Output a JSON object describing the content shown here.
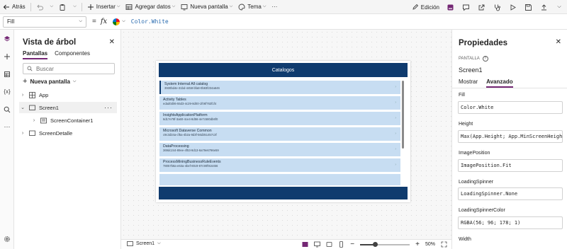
{
  "toolbar": {
    "back_label": "Atrás",
    "insert_label": "Insertar",
    "add_data_label": "Agregar datos",
    "new_screen_label": "Nueva pantalla",
    "theme_label": "Tema",
    "more_label": "···",
    "edit_label": "Edición"
  },
  "formula": {
    "property": "Fill",
    "equals": "=",
    "fx": "fx",
    "value": "Color.White"
  },
  "tree": {
    "title": "Vista de árbol",
    "tabs": [
      "Pantallas",
      "Componentes"
    ],
    "search_placeholder": "Buscar",
    "new_screen": "Nueva pantalla",
    "items": [
      {
        "label": "App"
      },
      {
        "label": "Screen1"
      },
      {
        "label": "ScreenContainer1"
      },
      {
        "label": "ScreenDetalle"
      }
    ],
    "more": "···"
  },
  "app": {
    "header_title": "Catalogos",
    "gallery": [
      {
        "title": "System Internal All catalog",
        "subtitle": "3930bd4e-31bd-4458-bfa8-0b83f234a646"
      },
      {
        "title": "Activity Tables",
        "subtitle": "edad0d06-55d3-4c29-8d00-1f06f763f1f4"
      },
      {
        "title": "InsightsApplicationPlatform",
        "subtitle": "6d17e78f-3a60-4ce4-8d56-4e7c580db6f0"
      },
      {
        "title": "Microsoft Dataverse Common",
        "subtitle": "c9c3d34a-cf5a-4b2a-9d3f-56d351457c3f"
      },
      {
        "title": "DataProcessing",
        "subtitle": "369dc244-89ee-4f53-9d13-6a79e6796e59"
      },
      {
        "title": "ProcessMiningBusinessRuleEvents",
        "subtitle": "78057b8a-e63a-4bef-80c9-87c90f916456"
      }
    ]
  },
  "status": {
    "screen": "Screen1",
    "zoom": "50%",
    "zoom_level": 0.3
  },
  "properties": {
    "title": "Propiedades",
    "type": "PANTALLA",
    "name": "Screen1",
    "tabs": [
      "Mostrar",
      "Avanzado"
    ],
    "items": [
      {
        "label": "Fill",
        "value": "Color.White"
      },
      {
        "label": "Height",
        "value": "Max(App.Height; App.MinScreenHeight)"
      },
      {
        "label": "ImagePosition",
        "value": "ImagePosition.Fit"
      },
      {
        "label": "LoadingSpinner",
        "value": "LoadingSpinner.None"
      },
      {
        "label": "LoadingSpinnerColor",
        "value": "RGBA(56; 96; 178; 1)"
      },
      {
        "label": "Width",
        "value": ""
      }
    ]
  },
  "colors": {
    "accent": "#742774",
    "app_header": "#0f3b6e",
    "gallery_item": "#c7ddf2"
  }
}
